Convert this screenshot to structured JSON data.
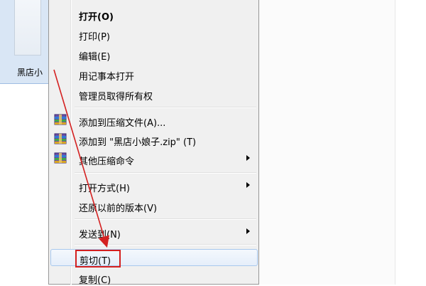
{
  "file": {
    "label": "黑店小"
  },
  "menu": {
    "items": [
      {
        "label": "打开(O)"
      },
      {
        "label": "打印(P)"
      },
      {
        "label": "编辑(E)"
      },
      {
        "label": "用记事本打开"
      },
      {
        "label": "管理员取得所有权"
      },
      {
        "label": "添加到压缩文件(A)..."
      },
      {
        "label": "添加到 \"黑店小娘子.zip\" (T)"
      },
      {
        "label": "其他压缩命令"
      },
      {
        "label": "打开方式(H)"
      },
      {
        "label": "还原以前的版本(V)"
      },
      {
        "label": "发送到(N)"
      },
      {
        "label": "剪切(T)"
      },
      {
        "label": "复制(C)"
      }
    ]
  },
  "colors": {
    "annotation": "#d42020",
    "selection": "#d9e6f5",
    "menu_bg": "#f0f0f0"
  },
  "icons": [
    "archive-icon",
    "submenu-arrow-icon"
  ]
}
